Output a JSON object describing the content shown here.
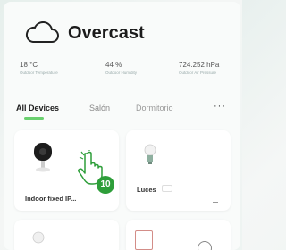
{
  "weather": {
    "condition": "Overcast",
    "stats": [
      {
        "value": "18 °C",
        "label": "Outdoor Temperature"
      },
      {
        "value": "44 %",
        "label": "Outdoor Humidity"
      },
      {
        "value": "724.252 hPa",
        "label": "Outdoor Air Pressure"
      }
    ]
  },
  "tabs": {
    "items": [
      "All Devices",
      "Salón",
      "Dormitorio"
    ],
    "more": "···"
  },
  "devices": [
    {
      "name": "Indoor fixed IP..."
    },
    {
      "name": "Luces"
    }
  ],
  "annotation": {
    "step": "10"
  },
  "colors": {
    "accent": "#6ad06f",
    "badge": "#2e9e3a"
  }
}
